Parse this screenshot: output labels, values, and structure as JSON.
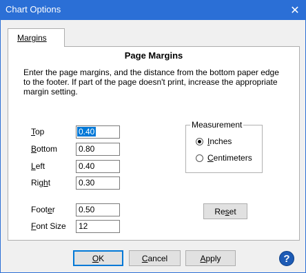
{
  "window": {
    "title": "Chart Options",
    "close_glyph": "✕"
  },
  "tab": {
    "label": "Margins"
  },
  "panel": {
    "heading": "Page Margins",
    "description": "Enter the page margins, and the distance from the bottom paper edge to the footer. If part of the page doesn't print, increase the appropriate margin setting."
  },
  "fields": {
    "top": {
      "label_key": "T",
      "label_rest": "op",
      "value": "0.40"
    },
    "bottom": {
      "label_key": "B",
      "label_rest": "ottom",
      "value": "0.80"
    },
    "left": {
      "label_key": "L",
      "label_rest": "eft",
      "value": "0.40"
    },
    "right": {
      "label_pre": "Rig",
      "label_key": "h",
      "label_rest": "t",
      "value": "0.30"
    },
    "footer": {
      "label_pre": "Foot",
      "label_key": "e",
      "label_rest": "r",
      "value": "0.50"
    },
    "font_size": {
      "label_key": "F",
      "label_rest": "ont Size",
      "value": "12"
    }
  },
  "measurement": {
    "legend": "Measurement",
    "options": [
      {
        "key": "I",
        "rest": "nches",
        "selected": true
      },
      {
        "key": "C",
        "rest": "entimeters",
        "selected": false
      }
    ]
  },
  "buttons": {
    "reset": {
      "pre": "Re",
      "key": "s",
      "rest": "et"
    },
    "ok": {
      "key": "O",
      "rest": "K"
    },
    "cancel": {
      "key": "C",
      "rest": "ancel"
    },
    "apply": {
      "key": "A",
      "rest": "pply"
    },
    "help_glyph": "?"
  },
  "colors": {
    "titlebar": "#2b6fd6",
    "selection": "#0078d7",
    "help": "#1d5bb5"
  }
}
